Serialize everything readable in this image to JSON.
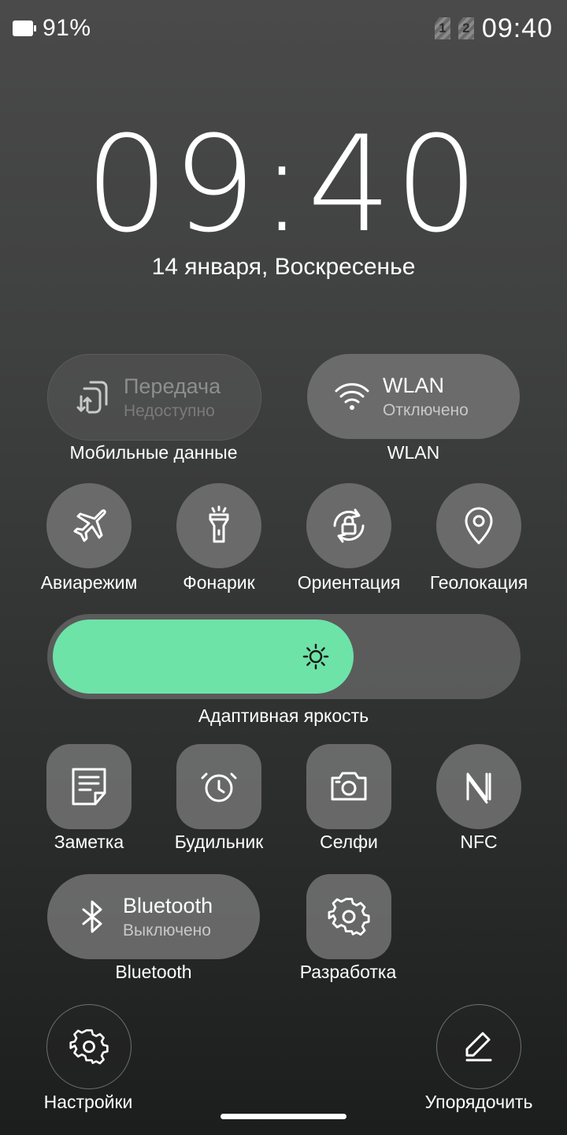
{
  "status_bar": {
    "battery_pct": "91%",
    "sim1": "1",
    "sim2": "2",
    "time": "09:40"
  },
  "lock": {
    "clock": "09:40",
    "date": "14 января, Воскресенье"
  },
  "tiles": {
    "mobile_data": {
      "title": "Передача",
      "subtitle": "Недоступно",
      "label": "Мобильные данные"
    },
    "wlan": {
      "title": "WLAN",
      "subtitle": "Отключено",
      "label": "WLAN"
    },
    "airplane": {
      "label": "Авиарежим"
    },
    "flashlight": {
      "label": "Фонарик"
    },
    "orientation": {
      "label": "Ориентация"
    },
    "location": {
      "label": "Геолокация"
    },
    "brightness": {
      "label": "Адаптивная яркость",
      "level": 0.65,
      "fill_color": "#6de3a8"
    },
    "note": {
      "label": "Заметка"
    },
    "alarm": {
      "label": "Будильник"
    },
    "selfie": {
      "label": "Селфи"
    },
    "nfc": {
      "label": "NFC"
    },
    "bluetooth": {
      "title": "Bluetooth",
      "subtitle": "Выключено",
      "label": "Bluetooth"
    },
    "developer": {
      "label": "Разработка"
    }
  },
  "bottom": {
    "settings_label": "Настройки",
    "arrange_label": "Упорядочить"
  }
}
